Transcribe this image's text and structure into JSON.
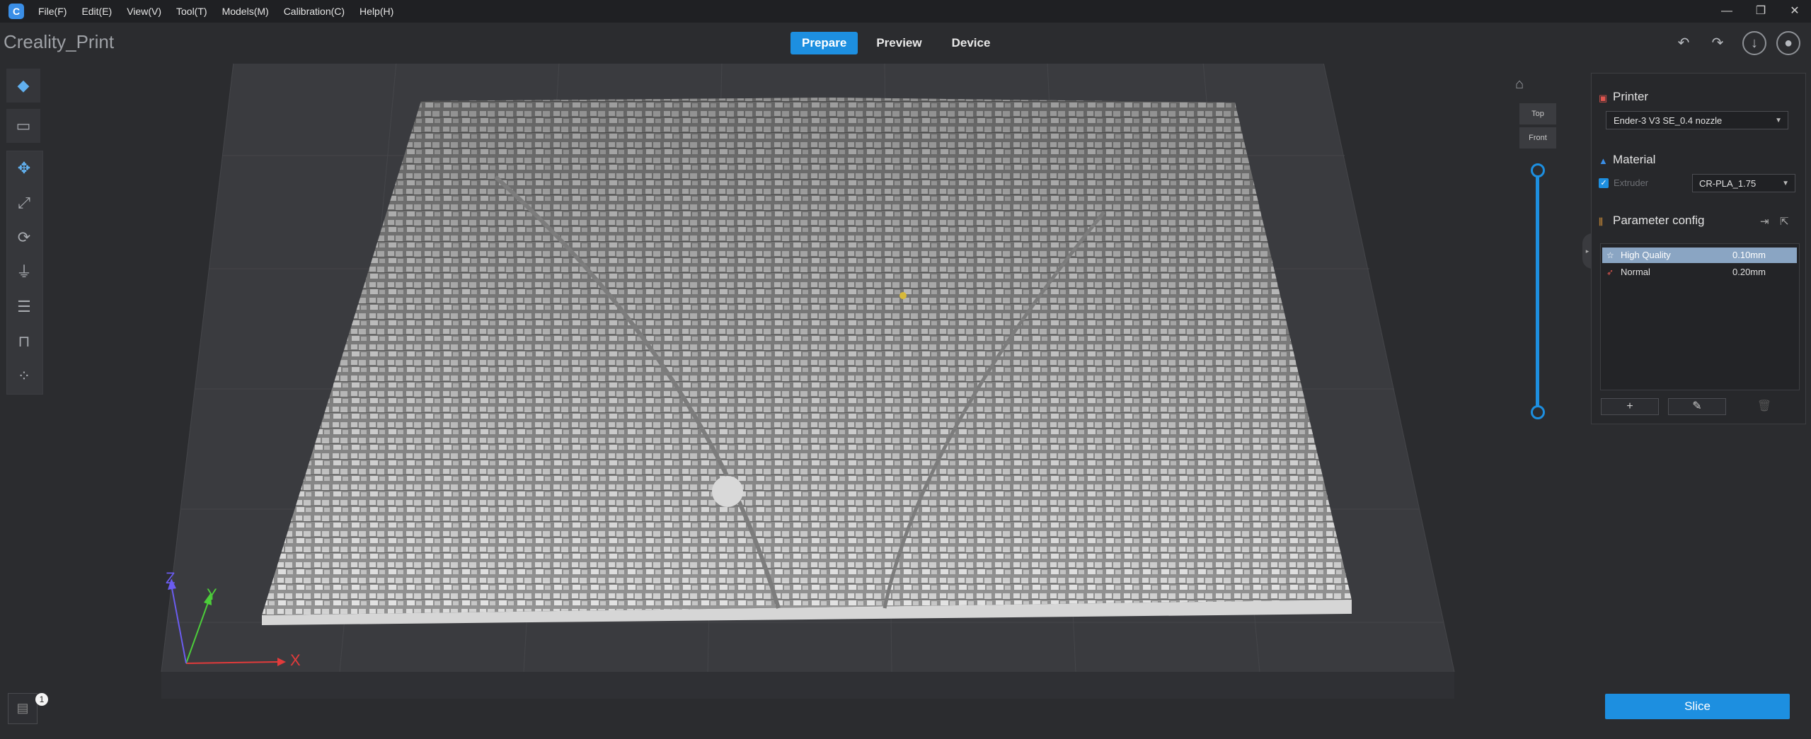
{
  "menubar": {
    "logo_letter": "C",
    "items": [
      "File(F)",
      "Edit(E)",
      "View(V)",
      "Tool(T)",
      "Models(M)",
      "Calibration(C)",
      "Help(H)"
    ]
  },
  "window_controls": {
    "minimize": "—",
    "restore": "❐",
    "close": "✕"
  },
  "app": {
    "title": "Creality_Print"
  },
  "mode_tabs": [
    {
      "label": "Prepare",
      "active": true
    },
    {
      "label": "Preview",
      "active": false
    },
    {
      "label": "Device",
      "active": false
    }
  ],
  "header_icons": [
    "undo-icon",
    "redo-icon",
    "download-icon",
    "user-icon"
  ],
  "left_toolbar": [
    "add-model-icon",
    "open-folder-icon",
    "move-icon",
    "scale-icon",
    "rotate-icon",
    "lay-flat-icon",
    "list-icon",
    "support-icon",
    "arrange-icon"
  ],
  "viewport": {
    "axes": {
      "x": "X",
      "y": "Y",
      "z": "Z"
    },
    "view_buttons": {
      "top": "Top",
      "front": "Front"
    },
    "doc_badge": "1"
  },
  "right_panel": {
    "printer": {
      "title": "Printer",
      "selected": "Ender-3 V3 SE_0.4 nozzle"
    },
    "material": {
      "title": "Material",
      "extruder_label": "Extruder",
      "extruder_checked": true,
      "selected": "CR-PLA_1.75"
    },
    "parameter_config": {
      "title": "Parameter config",
      "profiles": [
        {
          "name": "High Quality",
          "value": "0.10mm",
          "selected": true
        },
        {
          "name": "Normal",
          "value": "0.20mm",
          "selected": false
        }
      ],
      "buttons": {
        "add": "+",
        "edit": "✎",
        "delete": "🗑"
      }
    }
  },
  "slice_button": "Slice",
  "colors": {
    "accent": "#1d8fe0",
    "background": "#2b2c2f",
    "panel": "#27282b",
    "selected_row": "#8aa5c3",
    "axis_x": "#e23b3b",
    "axis_y": "#4ccd3a",
    "axis_z": "#6b5cf0"
  }
}
